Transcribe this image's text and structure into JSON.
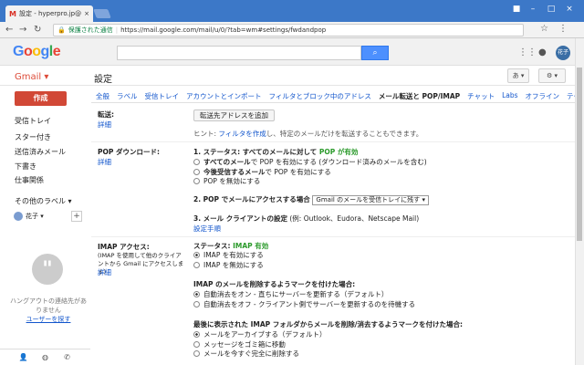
{
  "browser": {
    "tab_title": "設定 - hyperpro.jp@gm",
    "tab_close": "×",
    "window_user": "■",
    "minimize": "–",
    "maximize": "□",
    "close": "×",
    "secure_text": "保護された通信",
    "url": "https://mail.google.com/mail/u/0/?tab=wm#settings/fwdandpop"
  },
  "header": {
    "logo_letters": [
      {
        "ch": "G",
        "color": "#4285f4"
      },
      {
        "ch": "o",
        "color": "#ea4335"
      },
      {
        "ch": "o",
        "color": "#fbbc05"
      },
      {
        "ch": "g",
        "color": "#4285f4"
      },
      {
        "ch": "l",
        "color": "#34a853"
      },
      {
        "ch": "e",
        "color": "#ea4335"
      }
    ],
    "search_icon": "⌕",
    "avatar_text": "花子"
  },
  "subheader": {
    "gmail_label": "Gmail ▾",
    "page_title": "設定",
    "lang_button": "あ ▾",
    "settings_button": "⚙ ▾"
  },
  "sidebar": {
    "compose": "作成",
    "items": [
      "受信トレイ",
      "スター付き",
      "送信済みメール",
      "下書き",
      "仕事関係",
      "その他のラベル ▾"
    ],
    "user_name": "花子 ▾",
    "add": "+",
    "hangouts_icon": "\"",
    "hangouts_text": "ハングアウトの連絡先がありません",
    "hangouts_link": "ユーザーを探す"
  },
  "tabs": [
    "全般",
    "ラベル",
    "受信トレイ",
    "アカウントとインポート",
    "フィルタとブロック中のアドレス",
    "メール転送と POP/IMAP",
    "チャット",
    "Labs",
    "オフライン",
    "テーマ"
  ],
  "active_tab": "メール転送と POP/IMAP",
  "forwarding": {
    "label": "転送:",
    "learn": "詳細",
    "button": "転送先アドレスを追加",
    "hint_prefix": "ヒント: ",
    "hint_link": "フィルタを作成",
    "hint_suffix": "し、特定のメールだけを転送することもできます。"
  },
  "pop": {
    "label": "POP ダウンロード:",
    "learn": "詳細",
    "status_prefix": "1. ステータス: すべてのメールに対して ",
    "status_value": "POP が有効",
    "options": [
      {
        "bold": "すべてのメール",
        "text": "で POP を有効にする (ダウンロード済みのメールを含む)",
        "checked": false
      },
      {
        "bold": "今後受信するメール",
        "text": "で POP を有効にする",
        "checked": false
      },
      {
        "bold": "",
        "text": "POP を無効にする",
        "checked": false
      }
    ],
    "access_label": "2. POP でメールにアクセスする場合",
    "access_select": "Gmail のメールを受信トレイに残す",
    "client_label": "3. メール クライアントの設定",
    "client_examples": " (例: Outlook、Eudora、Netscape Mail)",
    "client_link": "設定手順"
  },
  "imap": {
    "label": "IMAP アクセス:",
    "desc": "(IMAP を使用して他のクライアントから Gmail にアクセスします)",
    "learn": "詳細",
    "status_prefix": "ステータス: ",
    "status_value": "IMAP 有効",
    "enable": [
      {
        "text": "IMAP を有効にする",
        "checked": true
      },
      {
        "text": "IMAP を無効にする",
        "checked": false
      }
    ],
    "deleted_title": "IMAP のメールを削除するようマークを付けた場合:",
    "deleted_options": [
      {
        "text": "自動消去をオン - 直ちにサーバーを更新する（デフォルト）",
        "checked": true
      },
      {
        "text": "自動消去をオフ - クライアント側でサーバーを更新するのを待機する",
        "checked": false
      }
    ],
    "expunge_title": "最後に表示された IMAP フォルダからメールを削除/消去するようマークを付けた場合:",
    "expunge_options": [
      {
        "text": "メールをアーカイブする（デフォルト）",
        "checked": true
      },
      {
        "text": "メッセージをゴミ箱に移動",
        "checked": false
      },
      {
        "text": "メールを今すぐ完全に削除する",
        "checked": false
      }
    ]
  }
}
